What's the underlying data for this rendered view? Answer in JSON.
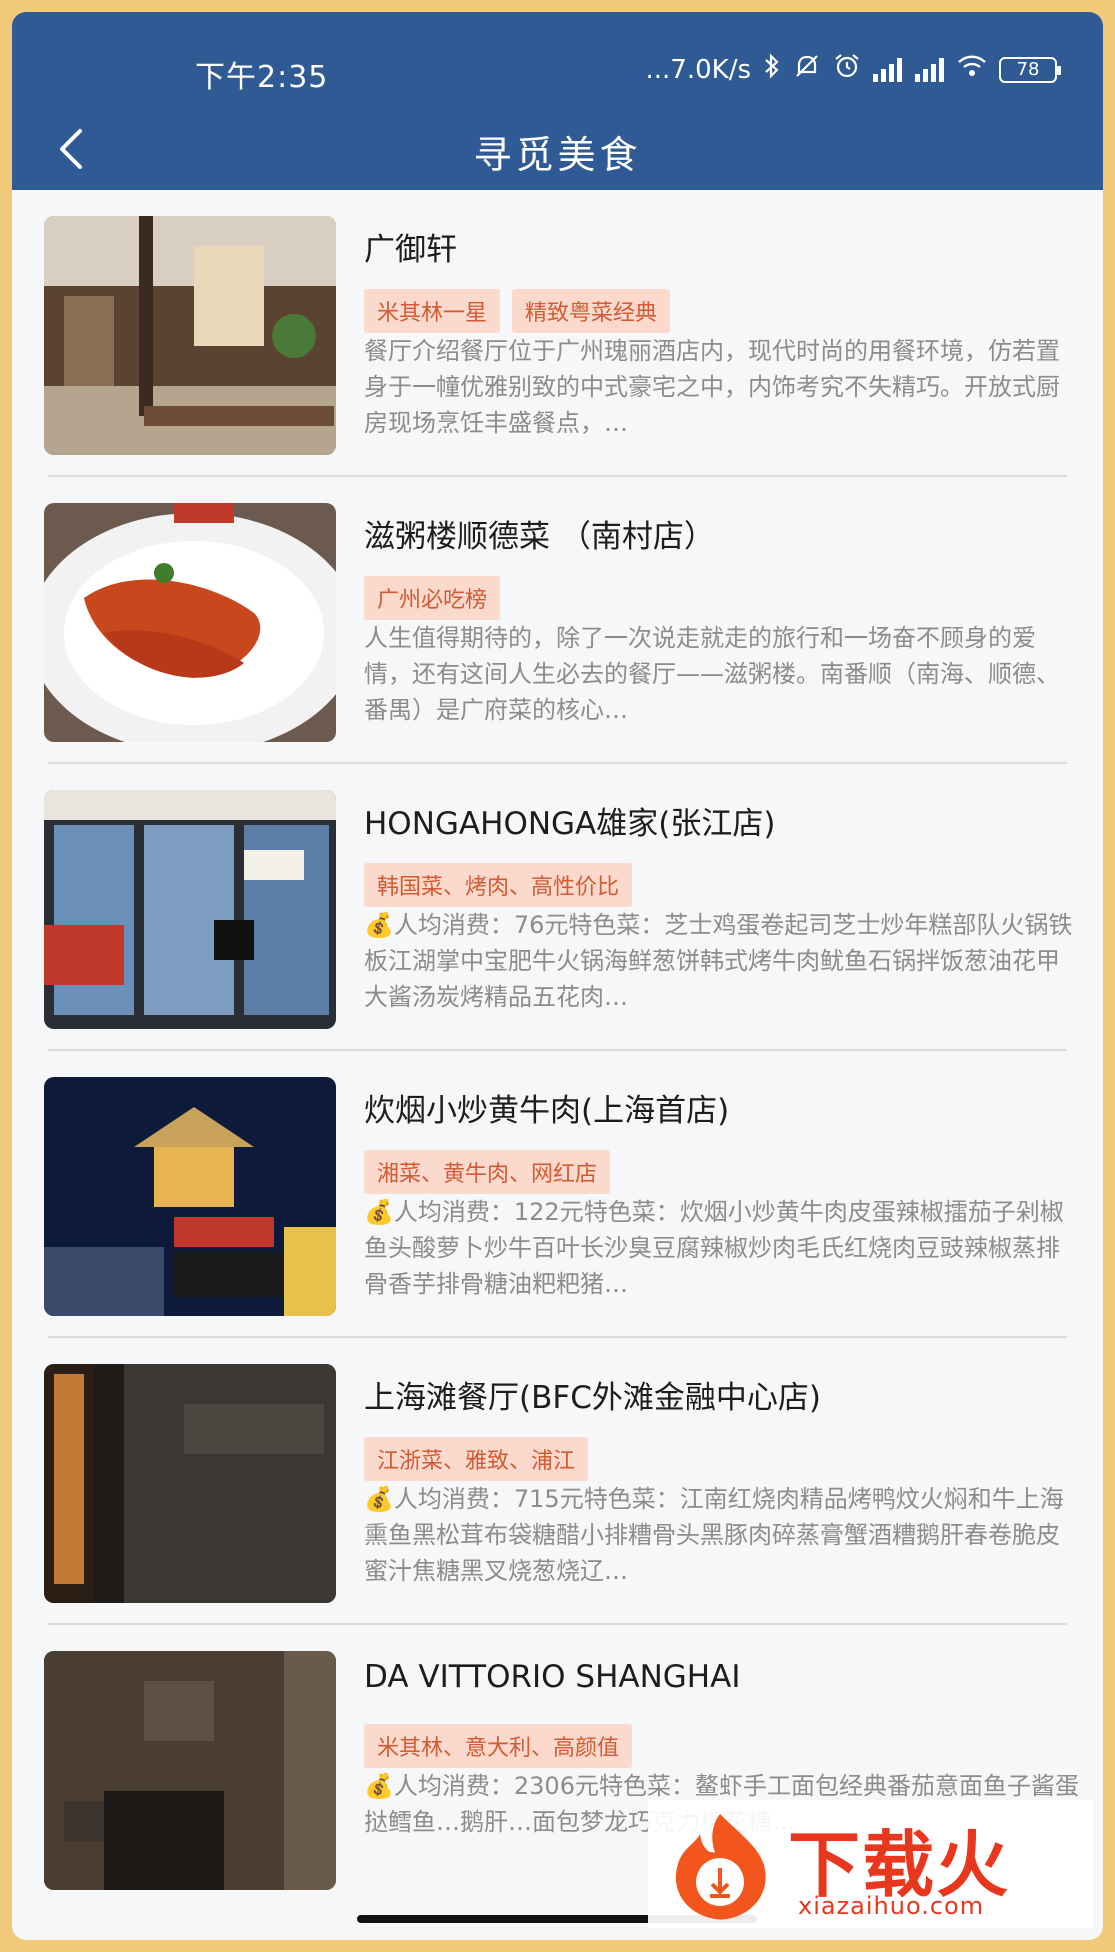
{
  "status_bar": {
    "time": "下午2:35",
    "network_speed": "...7.0K/s",
    "battery": "78",
    "icons": [
      "bluetooth-icon",
      "mute-icon",
      "alarm-icon",
      "hd-signal-icon",
      "hd-signal-icon",
      "wifi-icon",
      "battery-icon"
    ]
  },
  "header": {
    "title": "寻觅美食",
    "background": "#2f5a93"
  },
  "restaurants": [
    {
      "name": "广御轩",
      "tags": [
        "米其林一星",
        "精致粤菜经典"
      ],
      "description": "餐厅介绍餐厅位于广州瑰丽酒店内，现代时尚的用餐环境，仿若置身于一幢优雅别致的中式豪宅之中，内饰考究不失精巧。开放式厨房现场烹饪丰盛餐点，…"
    },
    {
      "name": "滋粥楼顺德菜 （南村店）",
      "tags": [
        "广州必吃榜"
      ],
      "description": "人生值得期待的，除了一次说走就走的旅行和一场奋不顾身的爱情，还有这间人生必去的餐厅——滋粥楼。南番顺（南海、顺德、番禺）是广府菜的核心…"
    },
    {
      "name": "HONGAHONGA雄家(张江店)",
      "tags": [
        "韩国菜、烤肉、高性价比"
      ],
      "description": "💰人均消费：76元特色菜：芝士鸡蛋卷起司芝士炒年糕部队火锅铁板江湖掌中宝肥牛火锅海鲜葱饼韩式烤牛肉鱿鱼石锅拌饭葱油花甲大酱汤炭烤精品五花肉…"
    },
    {
      "name": "炊烟小炒黄牛肉(上海首店)",
      "tags": [
        "湘菜、黄牛肉、网红店"
      ],
      "description": "💰人均消费：122元特色菜：炊烟小炒黄牛肉皮蛋辣椒擂茄子剁椒鱼头酸萝卜炒牛百叶长沙臭豆腐辣椒炒肉毛氏红烧肉豆豉辣椒蒸排骨香芋排骨糖油粑粑猪…"
    },
    {
      "name": "上海滩餐厅(BFC外滩金融中心店)",
      "tags": [
        "江浙菜、雅致、浦江"
      ],
      "description": "💰人均消费：715元特色菜：江南红烧肉精品烤鸭炆火焖和牛上海熏鱼黑松茸布袋糖醋小排糟骨头黑豚肉碎蒸膏蟹酒糟鹅肝春卷脆皮蜜汁焦糖黑叉烧葱烧辽…"
    },
    {
      "name": "DA VITTORIO SHANGHAI",
      "tags": [
        "米其林、意大利、高颜值"
      ],
      "description": "💰人均消费：2306元特色菜：鳌虾手工面包经典番茄意面鱼子酱蛋挞鳕鱼…鹅肝…面包梦龙巧克力棉花糖…"
    }
  ],
  "watermark": {
    "brand": "下载火",
    "url": "xiazaihuo.com"
  }
}
